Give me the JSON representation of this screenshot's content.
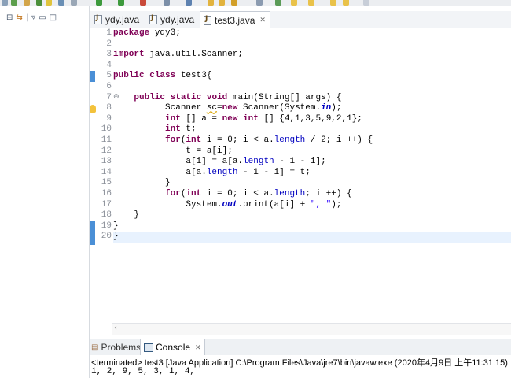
{
  "editor_tabs": [
    {
      "label": "ydy.java",
      "active": false
    },
    {
      "label": "ydy.java",
      "active": false
    },
    {
      "label": "test3.java",
      "active": true
    }
  ],
  "code_lines": [
    {
      "n": "1"
    },
    {
      "n": "2"
    },
    {
      "n": "3"
    },
    {
      "n": "4"
    },
    {
      "n": "5"
    },
    {
      "n": "6"
    },
    {
      "n": "7"
    },
    {
      "n": "8"
    },
    {
      "n": "9"
    },
    {
      "n": "10"
    },
    {
      "n": "11"
    },
    {
      "n": "12"
    },
    {
      "n": "13"
    },
    {
      "n": "14"
    },
    {
      "n": "15"
    },
    {
      "n": "16"
    },
    {
      "n": "17"
    },
    {
      "n": "18"
    },
    {
      "n": "19"
    },
    {
      "n": "20"
    }
  ],
  "code": {
    "l1_kw": "package",
    "l1_rest": " ydy3;",
    "l3_kw": "import",
    "l3_rest": " java.util.Scanner;",
    "l5_kw1": "public",
    "l5_kw2": "class",
    "l5_rest": " test3{",
    "l7_kw1": "public",
    "l7_kw2": "static",
    "l7_kw3": "void",
    "l7_rest": " main(String[] args) {",
    "l8_a": "Scanner ",
    "l8_var": "sc",
    "l8_eq": "=",
    "l8_kw": "new",
    "l8_b": " Scanner(System.",
    "l8_in": "in",
    "l8_c": ");",
    "l9_kw1": "int",
    "l9_a": " [] a = ",
    "l9_kw2": "new",
    "l9_kw3": "int",
    "l9_b": " [] {4,1,3,5,9,2,1};",
    "l10_kw": "int",
    "l10_rest": " t;",
    "l11_kw1": "for",
    "l11_p": "(",
    "l11_kw2": "int",
    "l11_a": " i = 0; i < a.",
    "l11_len": "length",
    "l11_b": " / 2; i ++) {",
    "l12": "t = a[i];",
    "l13_a": "a[i] = a[a.",
    "l13_len": "length",
    "l13_b": " - 1 - i];",
    "l14_a": "a[a.",
    "l14_len": "length",
    "l14_b": " - 1 - i] = t;",
    "l15": "}",
    "l16_kw1": "for",
    "l16_p": "(",
    "l16_kw2": "int",
    "l16_a": " i = 0; i < a.",
    "l16_len": "length",
    "l16_b": "; i ++) {",
    "l17_a": "System.",
    "l17_out": "out",
    "l17_b": ".print(a[i] + ",
    "l17_str": "\", \"",
    "l17_c": ");",
    "l18": "}",
    "l19": "}",
    "l20": "}"
  },
  "bottom_tabs": {
    "problems": "Problems",
    "console": "Console"
  },
  "console": {
    "status": "<terminated> test3 [Java Application] C:\\Program Files\\Java\\jre7\\bin\\javaw.exe (2020年4月9日 上午11:31:15)",
    "output": "1, 2, 9, 5, 3, 1, 4,"
  },
  "colors": {
    "keyword": "#7f0055",
    "field": "#0000c0",
    "string": "#2a00ff",
    "current_line": "#e8f2fe",
    "change_marker": "#4a8fd6"
  }
}
